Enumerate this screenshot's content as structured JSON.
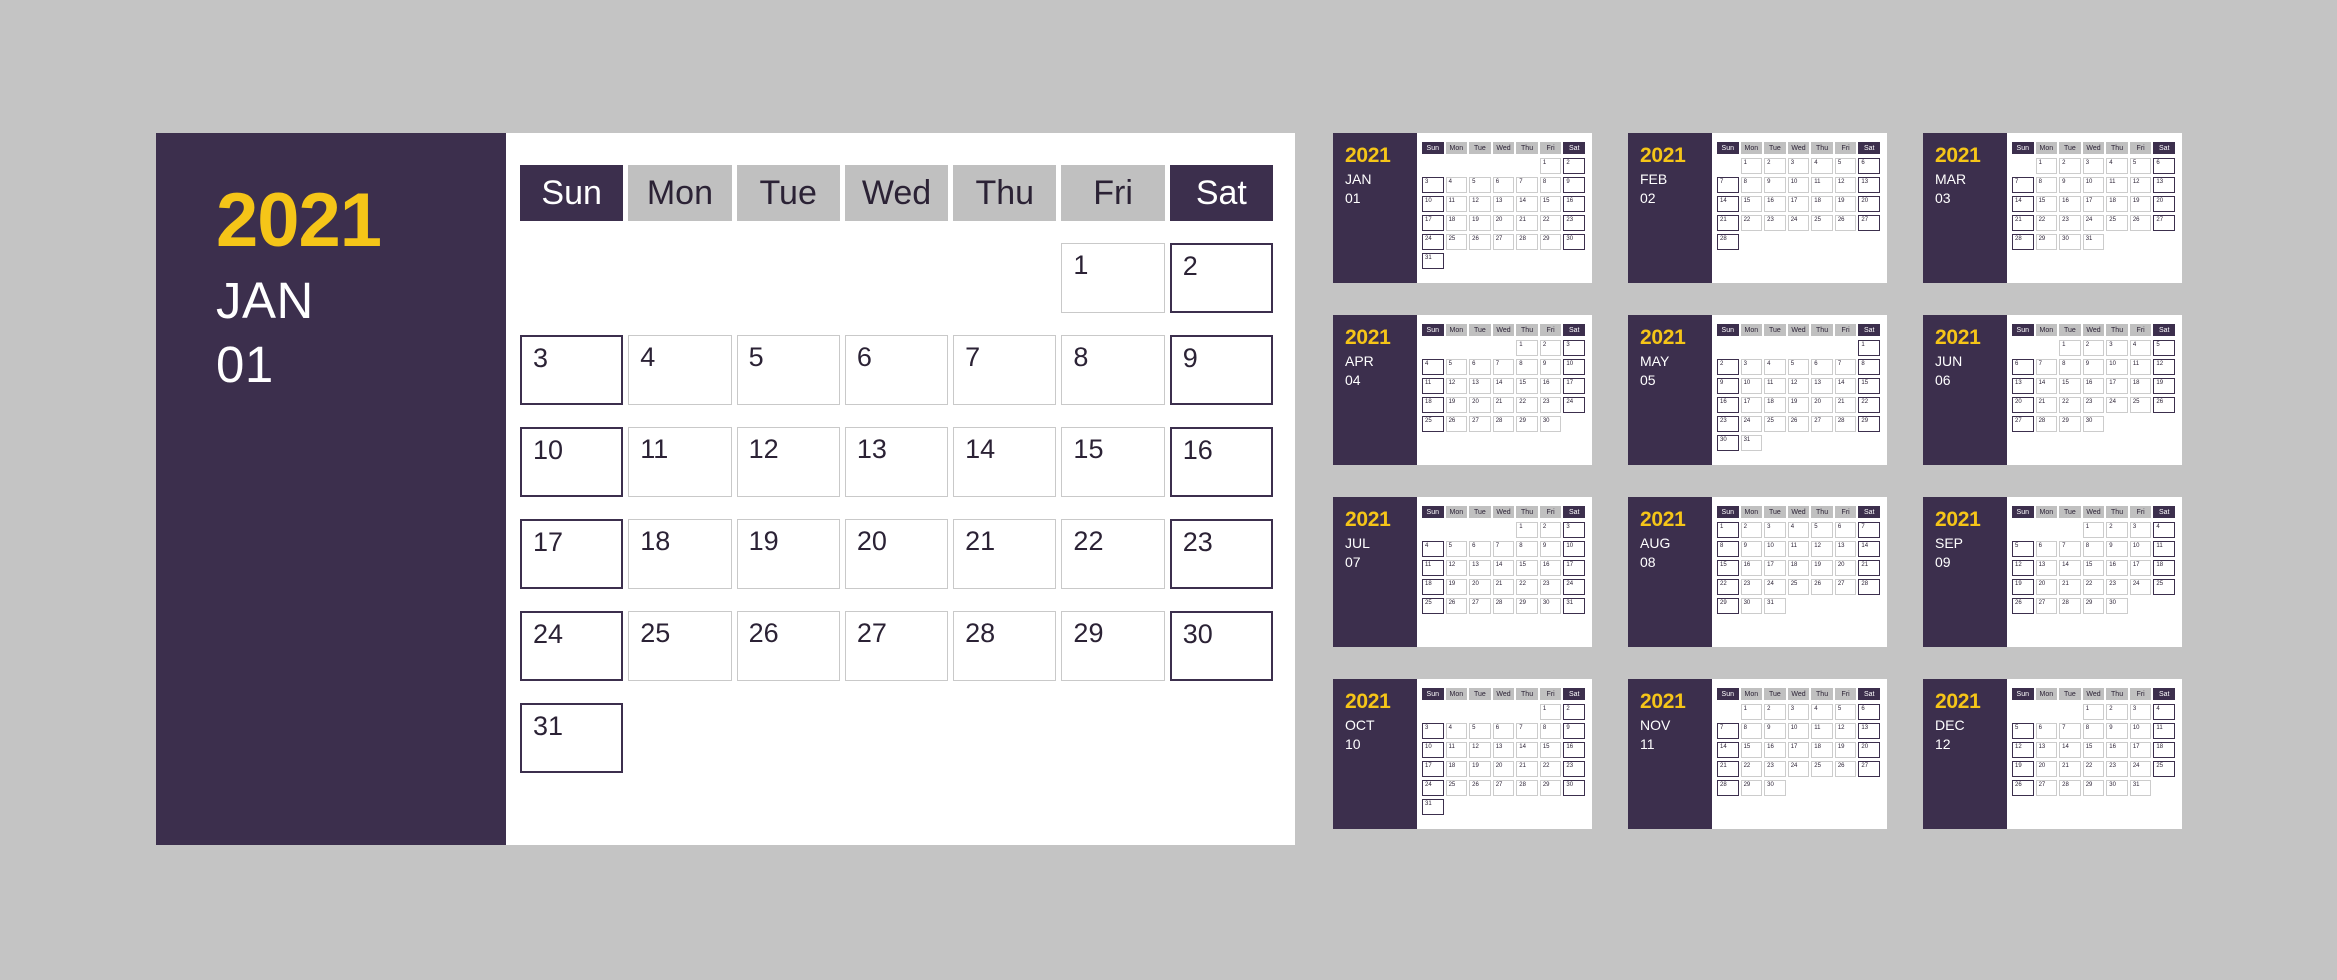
{
  "theme": {
    "background": "#c4c4c4",
    "accent_dark": "#3c2f4d",
    "accent_gold": "#f5c518",
    "header_gray": "#c0c0c0",
    "panel": "#ffffff"
  },
  "year": "2021",
  "weekdays": [
    "Sun",
    "Mon",
    "Tue",
    "Wed",
    "Thu",
    "Fri",
    "Sat"
  ],
  "weekend_indices": [
    0,
    6
  ],
  "main": {
    "year": "2021",
    "month_abbr": "JAN",
    "month_number": "01",
    "weekdays": [
      "Sun",
      "Mon",
      "Tue",
      "Wed",
      "Thu",
      "Fri",
      "Sat"
    ],
    "lead_blanks": 5,
    "days": [
      1,
      2,
      3,
      4,
      5,
      6,
      7,
      8,
      9,
      10,
      11,
      12,
      13,
      14,
      15,
      16,
      17,
      18,
      19,
      20,
      21,
      22,
      23,
      24,
      25,
      26,
      27,
      28,
      29,
      30,
      31
    ]
  },
  "months": [
    {
      "year": "2021",
      "month_abbr": "JAN",
      "month_number": "01",
      "lead_blanks": 5,
      "day_count": 31,
      "days": [
        1,
        2,
        3,
        4,
        5,
        6,
        7,
        8,
        9,
        10,
        11,
        12,
        13,
        14,
        15,
        16,
        17,
        18,
        19,
        20,
        21,
        22,
        23,
        24,
        25,
        26,
        27,
        28,
        29,
        30,
        31
      ]
    },
    {
      "year": "2021",
      "month_abbr": "FEB",
      "month_number": "02",
      "lead_blanks": 1,
      "day_count": 28,
      "days": [
        1,
        2,
        3,
        4,
        5,
        6,
        7,
        8,
        9,
        10,
        11,
        12,
        13,
        14,
        15,
        16,
        17,
        18,
        19,
        20,
        21,
        22,
        23,
        24,
        25,
        26,
        27,
        28
      ]
    },
    {
      "year": "2021",
      "month_abbr": "MAR",
      "month_number": "03",
      "lead_blanks": 1,
      "day_count": 31,
      "days": [
        1,
        2,
        3,
        4,
        5,
        6,
        7,
        8,
        9,
        10,
        11,
        12,
        13,
        14,
        15,
        16,
        17,
        18,
        19,
        20,
        21,
        22,
        23,
        24,
        25,
        26,
        27,
        28,
        29,
        30,
        31
      ]
    },
    {
      "year": "2021",
      "month_abbr": "APR",
      "month_number": "04",
      "lead_blanks": 4,
      "day_count": 30,
      "days": [
        1,
        2,
        3,
        4,
        5,
        6,
        7,
        8,
        9,
        10,
        11,
        12,
        13,
        14,
        15,
        16,
        17,
        18,
        19,
        20,
        21,
        22,
        23,
        24,
        25,
        26,
        27,
        28,
        29,
        30
      ]
    },
    {
      "year": "2021",
      "month_abbr": "MAY",
      "month_number": "05",
      "lead_blanks": 6,
      "day_count": 31,
      "days": [
        1,
        2,
        3,
        4,
        5,
        6,
        7,
        8,
        9,
        10,
        11,
        12,
        13,
        14,
        15,
        16,
        17,
        18,
        19,
        20,
        21,
        22,
        23,
        24,
        25,
        26,
        27,
        28,
        29,
        30,
        31
      ]
    },
    {
      "year": "2021",
      "month_abbr": "JUN",
      "month_number": "06",
      "lead_blanks": 2,
      "day_count": 30,
      "days": [
        1,
        2,
        3,
        4,
        5,
        6,
        7,
        8,
        9,
        10,
        11,
        12,
        13,
        14,
        15,
        16,
        17,
        18,
        19,
        20,
        21,
        22,
        23,
        24,
        25,
        26,
        27,
        28,
        29,
        30
      ]
    },
    {
      "year": "2021",
      "month_abbr": "JUL",
      "month_number": "07",
      "lead_blanks": 4,
      "day_count": 31,
      "days": [
        1,
        2,
        3,
        4,
        5,
        6,
        7,
        8,
        9,
        10,
        11,
        12,
        13,
        14,
        15,
        16,
        17,
        18,
        19,
        20,
        21,
        22,
        23,
        24,
        25,
        26,
        27,
        28,
        29,
        30,
        31
      ]
    },
    {
      "year": "2021",
      "month_abbr": "AUG",
      "month_number": "08",
      "lead_blanks": 0,
      "day_count": 31,
      "days": [
        1,
        2,
        3,
        4,
        5,
        6,
        7,
        8,
        9,
        10,
        11,
        12,
        13,
        14,
        15,
        16,
        17,
        18,
        19,
        20,
        21,
        22,
        23,
        24,
        25,
        26,
        27,
        28,
        29,
        30,
        31
      ]
    },
    {
      "year": "2021",
      "month_abbr": "SEP",
      "month_number": "09",
      "lead_blanks": 3,
      "day_count": 30,
      "days": [
        1,
        2,
        3,
        4,
        5,
        6,
        7,
        8,
        9,
        10,
        11,
        12,
        13,
        14,
        15,
        16,
        17,
        18,
        19,
        20,
        21,
        22,
        23,
        24,
        25,
        26,
        27,
        28,
        29,
        30
      ]
    },
    {
      "year": "2021",
      "month_abbr": "OCT",
      "month_number": "10",
      "lead_blanks": 5,
      "day_count": 31,
      "days": [
        1,
        2,
        3,
        4,
        5,
        6,
        7,
        8,
        9,
        10,
        11,
        12,
        13,
        14,
        15,
        16,
        17,
        18,
        19,
        20,
        21,
        22,
        23,
        24,
        25,
        26,
        27,
        28,
        29,
        30,
        31
      ]
    },
    {
      "year": "2021",
      "month_abbr": "NOV",
      "month_number": "11",
      "lead_blanks": 1,
      "day_count": 30,
      "days": [
        1,
        2,
        3,
        4,
        5,
        6,
        7,
        8,
        9,
        10,
        11,
        12,
        13,
        14,
        15,
        16,
        17,
        18,
        19,
        20,
        21,
        22,
        23,
        24,
        25,
        26,
        27,
        28,
        29,
        30
      ]
    },
    {
      "year": "2021",
      "month_abbr": "DEC",
      "month_number": "12",
      "lead_blanks": 3,
      "day_count": 31,
      "days": [
        1,
        2,
        3,
        4,
        5,
        6,
        7,
        8,
        9,
        10,
        11,
        12,
        13,
        14,
        15,
        16,
        17,
        18,
        19,
        20,
        21,
        22,
        23,
        24,
        25,
        26,
        27,
        28,
        29,
        30,
        31
      ]
    }
  ]
}
